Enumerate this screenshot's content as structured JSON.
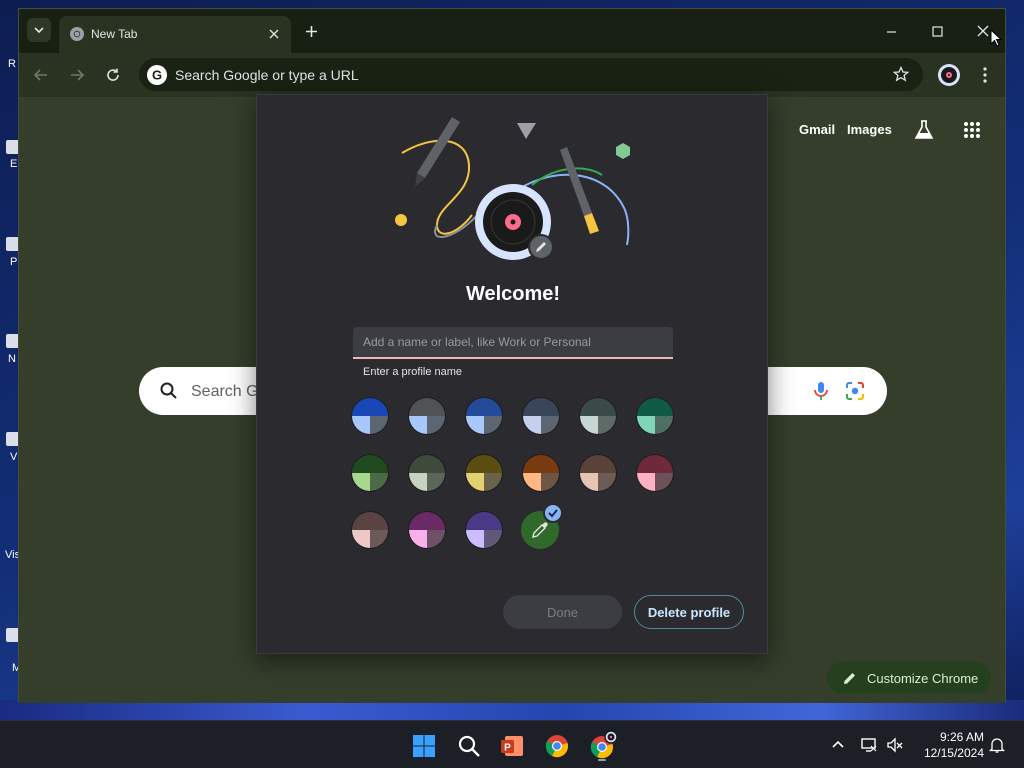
{
  "browser": {
    "tab_title": "New Tab",
    "omnibox_placeholder": "Search Google or type a URL",
    "customize_label": "Customize Chrome"
  },
  "ntp": {
    "links": {
      "gmail": "Gmail",
      "images": "Images"
    },
    "search_placeholder": "Search Go"
  },
  "desktop": {
    "icon_labels": [
      "R",
      "E",
      "P",
      "N",
      "V",
      "Vis",
      "M"
    ]
  },
  "dialog": {
    "title": "Welcome!",
    "name_placeholder": "Add a name or label, like Work or Personal",
    "name_hint": "Enter a profile name",
    "done_label": "Done",
    "delete_label": "Delete profile",
    "color_swatches": [
      {
        "top": "#1a47b8",
        "bottom_left": "#a8c7fa",
        "bottom_right": "#5c6673"
      },
      {
        "top": "#505356",
        "bottom_left": "#a8c7fa",
        "bottom_right": "#5c6673"
      },
      {
        "top": "#244b9a",
        "bottom_left": "#a8c7fa",
        "bottom_right": "#5c6673"
      },
      {
        "top": "#3b4559",
        "bottom_left": "#c3d1ee",
        "bottom_right": "#5c6673"
      },
      {
        "top": "#3a4a46",
        "bottom_left": "#c7d6d0",
        "bottom_right": "#5f6b68"
      },
      {
        "top": "#0f5a45",
        "bottom_left": "#7fd6b6",
        "bottom_right": "#4f6e64"
      },
      {
        "top": "#1f4a1e",
        "bottom_left": "#a8d88e",
        "bottom_right": "#4d6a46"
      },
      {
        "top": "#3d4a3c",
        "bottom_left": "#c6d2c2",
        "bottom_right": "#5b6657"
      },
      {
        "top": "#5a4f10",
        "bottom_left": "#e3d070",
        "bottom_right": "#6a634a"
      },
      {
        "top": "#7a3a0f",
        "bottom_left": "#ffb784",
        "bottom_right": "#6e5646"
      },
      {
        "top": "#5b4239",
        "bottom_left": "#e7c3b4",
        "bottom_right": "#6d5c55"
      },
      {
        "top": "#6e2a3a",
        "bottom_left": "#ffb0c3",
        "bottom_right": "#6e5058"
      },
      {
        "top": "#5a4343",
        "bottom_left": "#ecc9c4",
        "bottom_right": "#6b5a58"
      },
      {
        "top": "#6a2a66",
        "bottom_left": "#f7b0ea",
        "bottom_right": "#6e5169"
      },
      {
        "top": "#4a3a86",
        "bottom_left": "#cdbdff",
        "bottom_right": "#5f5879"
      }
    ],
    "custom_color": "#2f6a2a"
  },
  "taskbar": {
    "time": "9:26 AM",
    "date": "12/15/2024"
  }
}
